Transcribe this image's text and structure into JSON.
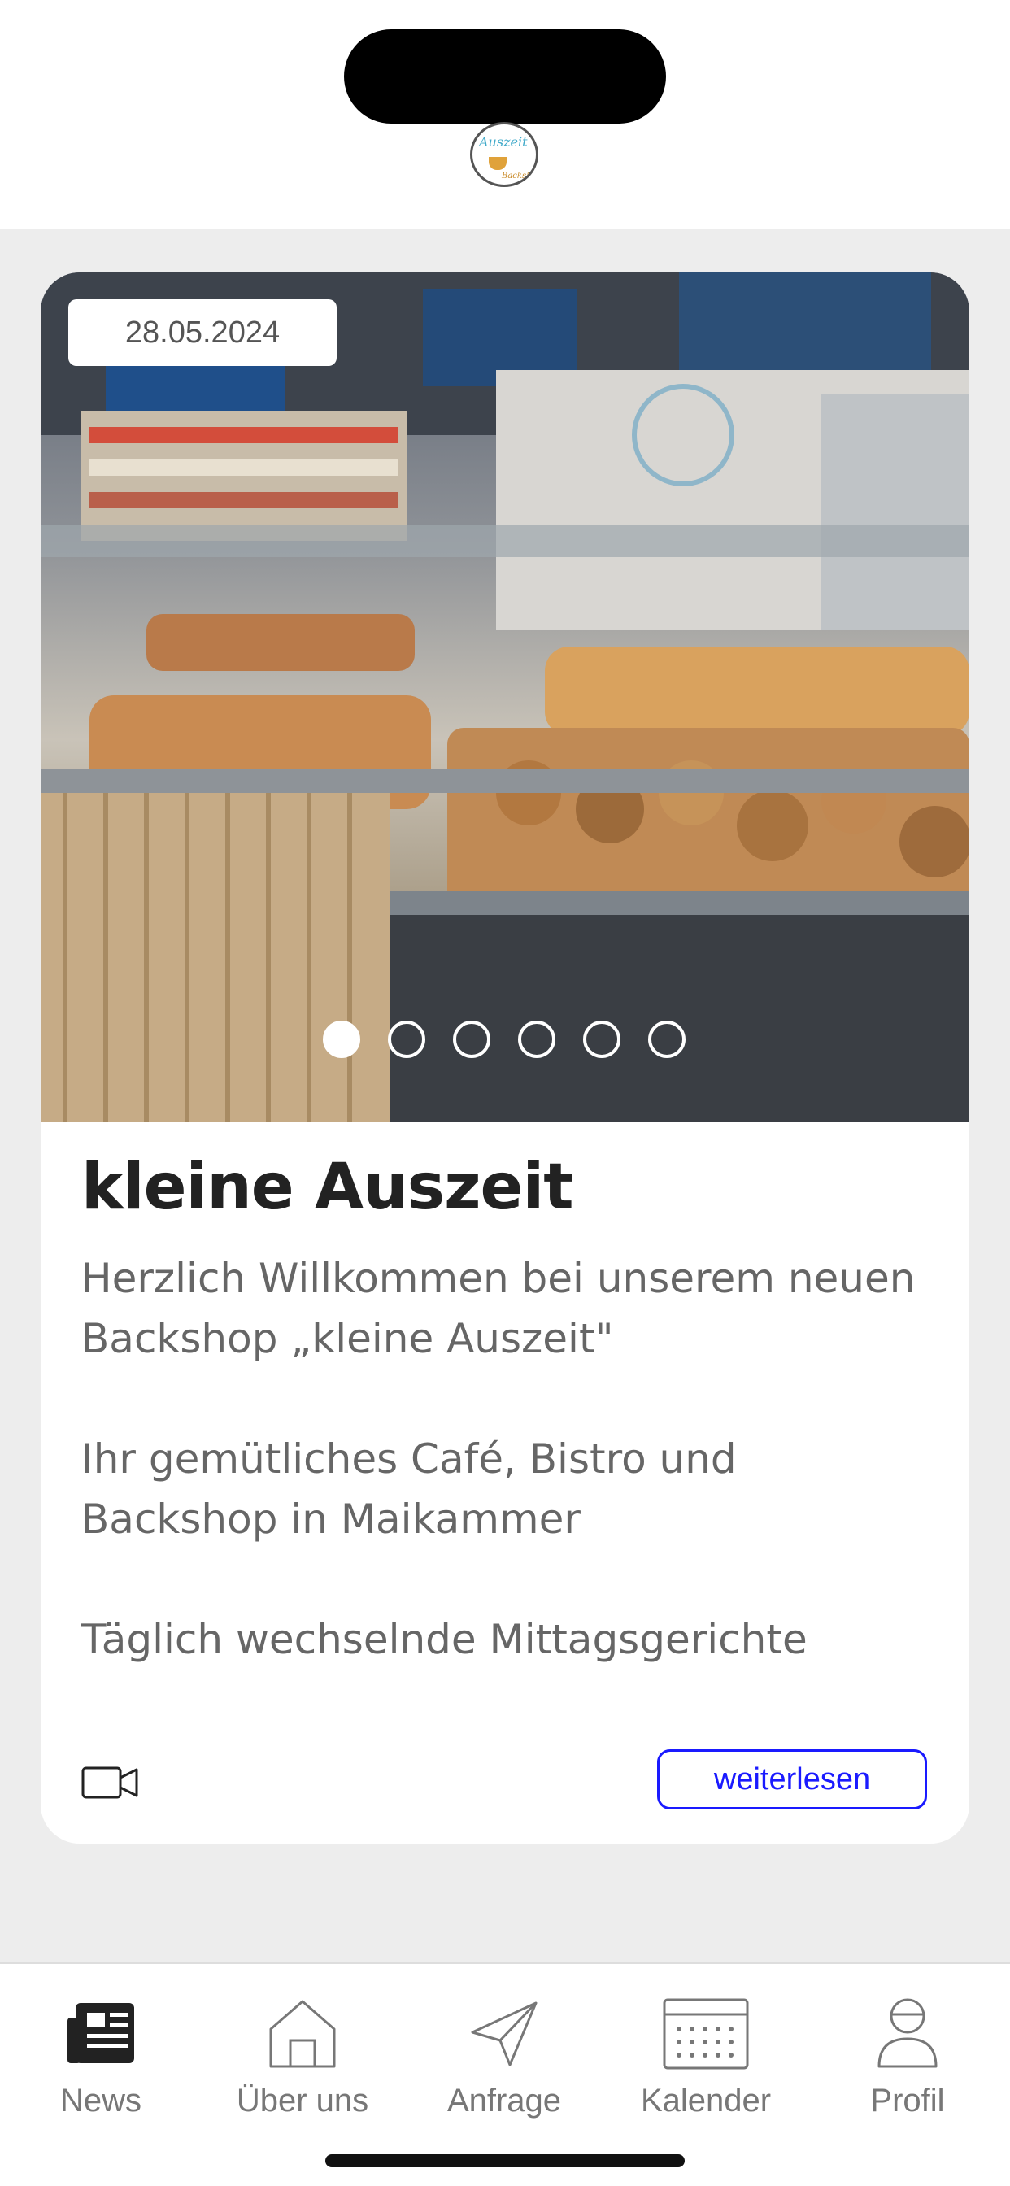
{
  "post": {
    "date": "28.05.2024",
    "title": "kleine Auszeit",
    "paragraph_1": "Herzlich Willkommen bei unserem neuen Backshop „kleine Auszeit\"",
    "paragraph_2": "Ihr gemütliches Café, Bistro und Backshop in Maikammer",
    "paragraph_3": "Täglich wechselnde Mittagsgerichte",
    "read_more_label": "weiterlesen",
    "carousel": {
      "count": 6,
      "active_index": 0
    }
  },
  "tabs": [
    {
      "label": "News",
      "icon": "newspaper-icon",
      "active": true
    },
    {
      "label": "Über uns",
      "icon": "home-icon",
      "active": false
    },
    {
      "label": "Anfrage",
      "icon": "paper-plane-icon",
      "active": false
    },
    {
      "label": "Kalender",
      "icon": "calendar-icon",
      "active": false
    },
    {
      "label": "Profil",
      "icon": "person-icon",
      "active": false
    }
  ],
  "colors": {
    "accent": "#1a1aff",
    "background": "#ededed"
  }
}
